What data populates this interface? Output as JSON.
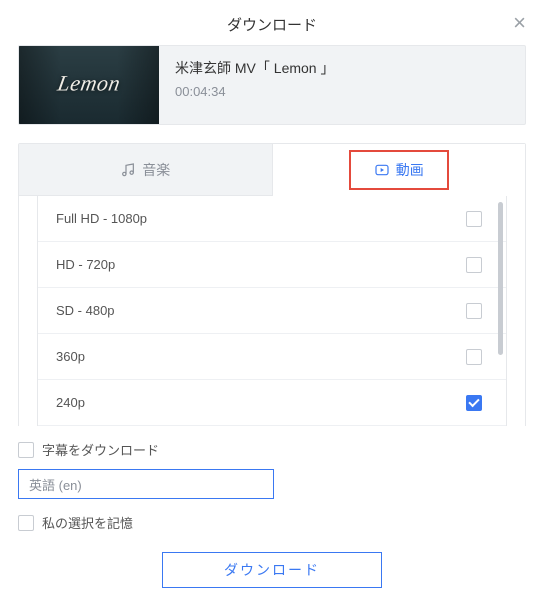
{
  "dialog": {
    "title": "ダウンロード"
  },
  "media": {
    "thumb_text": "Lemon",
    "title": "米津玄師  MV「 Lemon 」",
    "duration": "00:04:34"
  },
  "tabs": {
    "music": "音楽",
    "video": "動画"
  },
  "qualities": [
    {
      "label": "Full HD - 1080p",
      "checked": false
    },
    {
      "label": "HD - 720p",
      "checked": false
    },
    {
      "label": "SD - 480p",
      "checked": false
    },
    {
      "label": "360p",
      "checked": false
    },
    {
      "label": "240p",
      "checked": true
    }
  ],
  "options": {
    "subtitle_label": "字幕をダウンロード",
    "language_value": "英語 (en)",
    "remember_label": "私の選択を記憶"
  },
  "buttons": {
    "download": "ダウンロード"
  }
}
